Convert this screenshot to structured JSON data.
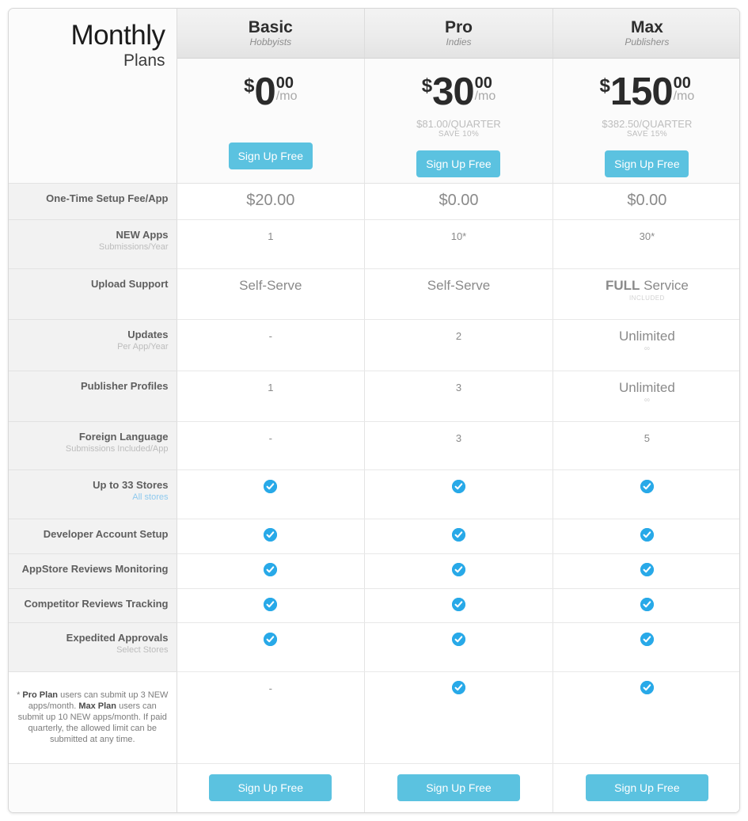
{
  "header": {
    "title_main": "Monthly",
    "title_sub": "Plans",
    "plans": [
      {
        "name": "Basic",
        "tagline": "Hobbyists",
        "currency": "$",
        "amount": "0",
        "cents": "00",
        "per": "/mo",
        "quarter": "",
        "save": "",
        "cta": "Sign Up Free"
      },
      {
        "name": "Pro",
        "tagline": "Indies",
        "currency": "$",
        "amount": "30",
        "cents": "00",
        "per": "/mo",
        "quarter": "$81.00/QUARTER",
        "save": "SAVE 10%",
        "cta": "Sign Up Free"
      },
      {
        "name": "Max",
        "tagline": "Publishers",
        "currency": "$",
        "amount": "150",
        "cents": "00",
        "per": "/mo",
        "quarter": "$382.50/QUARTER",
        "save": "SAVE 15%",
        "cta": "Sign Up Free"
      }
    ]
  },
  "rows": [
    {
      "label": "One-Time Setup Fee/App",
      "sublabel": "",
      "sublabel_link": false,
      "values": [
        {
          "type": "text",
          "main": "$20.00",
          "size": "money",
          "sub": ""
        },
        {
          "type": "text",
          "main": "$0.00",
          "size": "money",
          "sub": ""
        },
        {
          "type": "text",
          "main": "$0.00",
          "size": "money",
          "sub": ""
        }
      ]
    },
    {
      "label": "NEW Apps",
      "sublabel": "Submissions/Year",
      "sublabel_link": false,
      "values": [
        {
          "type": "text",
          "main": "1",
          "size": "small",
          "sub": ""
        },
        {
          "type": "text",
          "main": "10*",
          "size": "small",
          "sub": ""
        },
        {
          "type": "text",
          "main": "30*",
          "size": "small",
          "sub": ""
        }
      ]
    },
    {
      "label": "Upload Support",
      "sublabel": "",
      "sublabel_link": false,
      "values": [
        {
          "type": "text",
          "main": "Self-Serve",
          "size": "",
          "sub": ""
        },
        {
          "type": "text",
          "main": "Self-Serve",
          "size": "",
          "sub": ""
        },
        {
          "type": "rich",
          "bold": "FULL",
          "rest": " Service",
          "size": "",
          "sub": "INCLUDED"
        }
      ]
    },
    {
      "label": "Updates",
      "sublabel": "Per App/Year",
      "sublabel_link": false,
      "values": [
        {
          "type": "text",
          "main": "-",
          "size": "small",
          "sub": ""
        },
        {
          "type": "text",
          "main": "2",
          "size": "small",
          "sub": ""
        },
        {
          "type": "text",
          "main": "Unlimited",
          "size": "",
          "sub": "∞"
        }
      ]
    },
    {
      "label": "Publisher Profiles",
      "sublabel": "",
      "sublabel_link": false,
      "values": [
        {
          "type": "text",
          "main": "1",
          "size": "small",
          "sub": ""
        },
        {
          "type": "text",
          "main": "3",
          "size": "small",
          "sub": ""
        },
        {
          "type": "text",
          "main": "Unlimited",
          "size": "",
          "sub": "∞"
        }
      ]
    },
    {
      "label": "Foreign Language",
      "sublabel": "Submissions Included/App",
      "sublabel_link": false,
      "values": [
        {
          "type": "text",
          "main": "-",
          "size": "small",
          "sub": ""
        },
        {
          "type": "text",
          "main": "3",
          "size": "small",
          "sub": ""
        },
        {
          "type": "text",
          "main": "5",
          "size": "small",
          "sub": ""
        }
      ]
    },
    {
      "label": "Up to 33 Stores",
      "sublabel": "All stores",
      "sublabel_link": true,
      "values": [
        {
          "type": "check"
        },
        {
          "type": "check"
        },
        {
          "type": "check"
        }
      ]
    },
    {
      "label": "Developer Account Setup",
      "sublabel": "",
      "sublabel_link": false,
      "values": [
        {
          "type": "check"
        },
        {
          "type": "check"
        },
        {
          "type": "check"
        }
      ]
    },
    {
      "label": "AppStore Reviews Monitoring",
      "sublabel": "",
      "sublabel_link": false,
      "values": [
        {
          "type": "check"
        },
        {
          "type": "check"
        },
        {
          "type": "check"
        }
      ]
    },
    {
      "label": "Competitor Reviews Tracking",
      "sublabel": "",
      "sublabel_link": false,
      "values": [
        {
          "type": "check"
        },
        {
          "type": "check"
        },
        {
          "type": "check"
        }
      ]
    },
    {
      "label": "Expedited Approvals",
      "sublabel": "Select Stores",
      "sublabel_link": false,
      "values": [
        {
          "type": "check"
        },
        {
          "type": "check"
        },
        {
          "type": "check"
        }
      ]
    }
  ],
  "footnote_row": {
    "footnote_parts": [
      {
        "text": "* ",
        "bold": false
      },
      {
        "text": "Pro Plan",
        "bold": true
      },
      {
        "text": " users can submit up 3 NEW apps/month. ",
        "bold": false
      },
      {
        "text": "Max Plan",
        "bold": true
      },
      {
        "text": " users can submit up 10 NEW apps/month. If paid quarterly, the allowed limit can be submitted at any time.",
        "bold": false
      }
    ],
    "values": [
      {
        "type": "text",
        "main": "-",
        "size": "small",
        "sub": ""
      },
      {
        "type": "check"
      },
      {
        "type": "check"
      }
    ]
  },
  "footer_cta": [
    {
      "label": "Sign Up Free"
    },
    {
      "label": "Sign Up Free"
    },
    {
      "label": "Sign Up Free"
    }
  ],
  "colors": {
    "accent": "#5bc2e0",
    "check": "#28a9e8",
    "link": "#8ec9ee",
    "label_bg": "#f2f2f2",
    "header_bg": "#ececec"
  }
}
